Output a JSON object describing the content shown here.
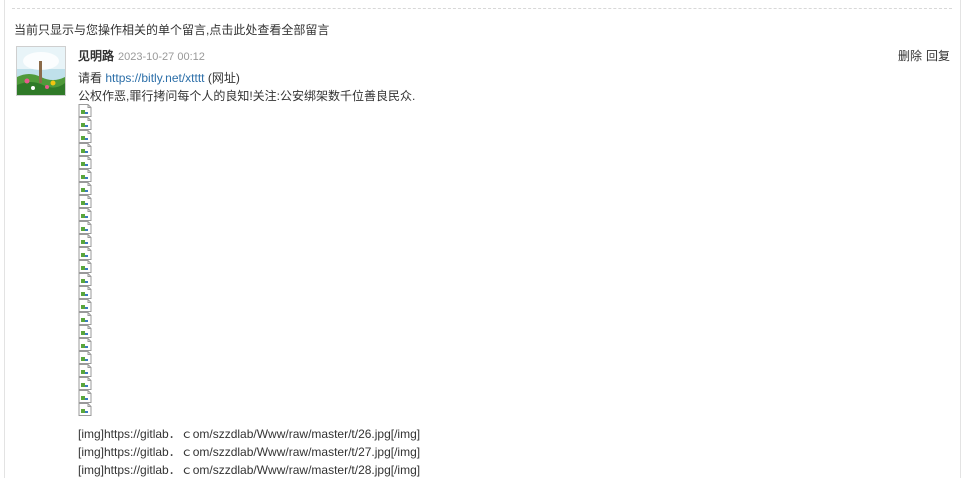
{
  "notice_text": "当前只显示与您操作相关的单个留言,点击此处查看全部留言",
  "comment": {
    "author": "见明路",
    "date": "2023-10-27 00:12",
    "actions": {
      "delete_label": "删除",
      "reply_label": "回复"
    },
    "line1_prefix": "请看",
    "line1_link": "https://bitly.net/xtttt",
    "line1_suffix": "(网址)",
    "line2": "公权作恶,罪行拷问每个人的良知!关注:公安绑架数千位善良民众.",
    "broken_image_count": 24,
    "img_lines": [
      "[img]https://gitlab．ｃom/szzdlab/Www/raw/master/t/26.jpg[/img]",
      "[img]https://gitlab．ｃom/szzdlab/Www/raw/master/t/27.jpg[/img]",
      "[img]https://gitlab．ｃom/szzdlab/Www/raw/master/t/28.jpg[/img]"
    ]
  },
  "colors": {
    "link": "#2b6ea8",
    "date": "#999999",
    "text": "#333333",
    "divider": "#d8d8d8"
  },
  "icons": {
    "avatar": "avatar-image",
    "broken_image": "broken-image-icon"
  }
}
